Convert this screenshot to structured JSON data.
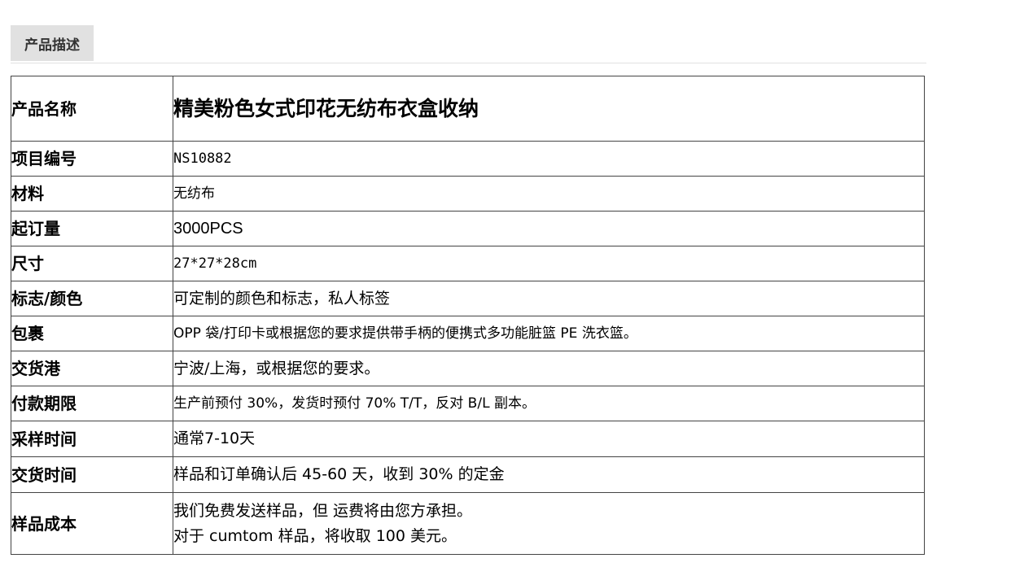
{
  "tab": {
    "label": "产品描述"
  },
  "rows": [
    {
      "key": "产品名称",
      "value": "精美粉色女式印花无纺布衣盒收纳"
    },
    {
      "key": "项目编号",
      "value": "NS10882"
    },
    {
      "key": "材料",
      "value": "无纺布"
    },
    {
      "key": "起订量",
      "value": "3000PCS"
    },
    {
      "key": "尺寸",
      "value": "27*27*28cm"
    },
    {
      "key": "标志/颜色",
      "value": "可定制的颜色和标志，私人标签"
    },
    {
      "key": "包裹",
      "value": "OPP 袋/打印卡或根据您的要求提供带手柄的便携式多功能脏篮 PE 洗衣篮。"
    },
    {
      "key": "交货港",
      "value": "宁波/上海，或根据您的要求。"
    },
    {
      "key": "付款期限",
      "value": "生产前预付 30%，发货时预付 70% T/T，反对 B/L 副本。"
    },
    {
      "key": "采样时间",
      "value": "通常7-10天"
    },
    {
      "key": "交货时间",
      "value": "样品和订单确认后 45-60 天，收到 30% 的定金"
    },
    {
      "key": "样品成本",
      "value_lines": [
        "我们免费发送样品，但 运费将由您方承担。",
        "对于 cumtom 样品，将收取 100 美元。"
      ]
    }
  ]
}
